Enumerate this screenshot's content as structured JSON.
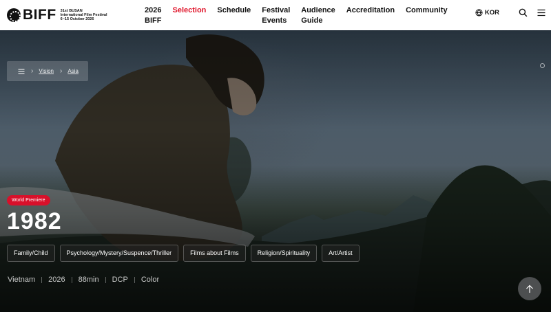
{
  "brand": {
    "wordmark": "BIFF",
    "edition": "31st BUSAN",
    "festival_name": "International Film Festival",
    "dates": "6~15 October 2026"
  },
  "nav": {
    "items": [
      {
        "line1": "2026",
        "line2": "BIFF",
        "active": false
      },
      {
        "line1": "Selection",
        "line2": "",
        "active": true
      },
      {
        "line1": "Schedule",
        "line2": "",
        "active": false
      },
      {
        "line1": "Festival",
        "line2": "Events",
        "active": false
      },
      {
        "line1": "Audience",
        "line2": "Guide",
        "active": false
      },
      {
        "line1": "Accreditation",
        "line2": "",
        "active": false
      },
      {
        "line1": "Community",
        "line2": "",
        "active": false
      }
    ],
    "active_color": "#e0142a"
  },
  "header_right": {
    "language": "KOR",
    "icons": [
      "globe-icon",
      "search-icon",
      "hamburger-menu-icon"
    ]
  },
  "breadcrumb": {
    "items": [
      "Vision",
      "Asia"
    ]
  },
  "film": {
    "badge": "World Premiere",
    "title": "1982",
    "genres": [
      "Family/Child",
      "Psychology/Mystery/Suspence/Thriller",
      "Films about Films",
      "Religion/Spirituality",
      "Art/Artist"
    ],
    "meta": [
      "Vietnam",
      "2026",
      "88min",
      "DCP",
      "Color"
    ]
  },
  "colors": {
    "accent": "#d8102a",
    "header_bg": "#ffffff"
  },
  "scroll_top_icon": "arrow-up-icon"
}
